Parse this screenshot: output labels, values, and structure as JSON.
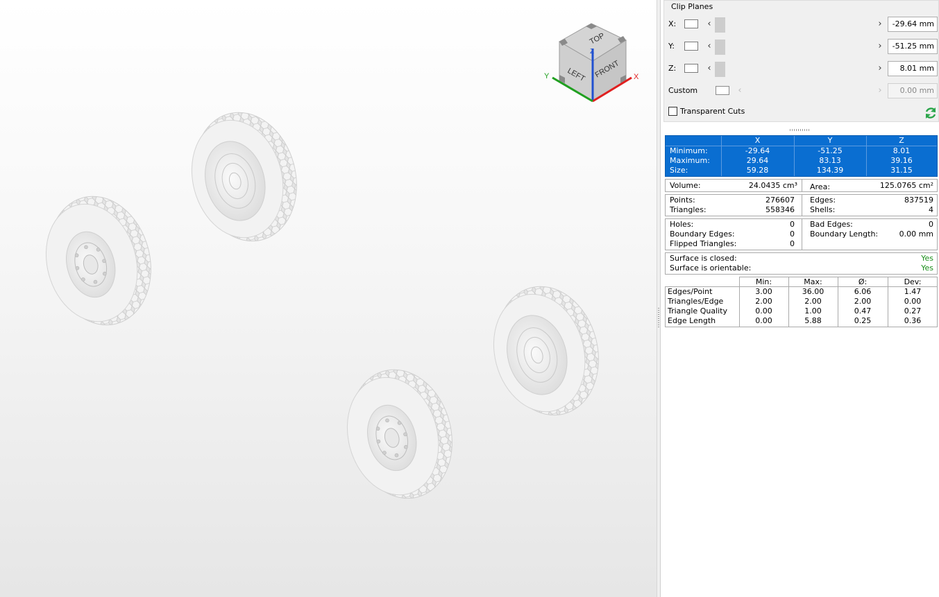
{
  "clip_planes": {
    "title": "Clip Planes",
    "rows": [
      {
        "label": "X:",
        "value": "-29.64 mm"
      },
      {
        "label": "Y:",
        "value": "-51.25 mm"
      },
      {
        "label": "Z:",
        "value": "8.01 mm"
      },
      {
        "label": "Custom",
        "value": "0.00 mm"
      }
    ],
    "transparent_cuts": "Transparent Cuts"
  },
  "nav_cube": {
    "top": "TOP",
    "left": "LEFT",
    "front": "FRONT",
    "x": "X",
    "y": "Y",
    "z": "Z"
  },
  "bbox": {
    "headers": [
      "X",
      "Y",
      "Z"
    ],
    "rows": [
      {
        "label": "Minimum:",
        "values": [
          "-29.64",
          "-51.25",
          "8.01"
        ]
      },
      {
        "label": "Maximum:",
        "values": [
          "29.64",
          "83.13",
          "39.16"
        ]
      },
      {
        "label": "Size:",
        "values": [
          "59.28",
          "134.39",
          "31.15"
        ]
      }
    ]
  },
  "volume": {
    "label": "Volume:",
    "value": "24.0435 cm³"
  },
  "area": {
    "label": "Area:",
    "value": "125.0765 cm²"
  },
  "mesh": {
    "points_label": "Points:",
    "points": "276607",
    "triangles_label": "Triangles:",
    "triangles": "558346",
    "edges_label": "Edges:",
    "edges": "837519",
    "shells_label": "Shells:",
    "shells": "4"
  },
  "errors": {
    "holes_label": "Holes:",
    "holes": "0",
    "boundary_edges_label": "Boundary Edges:",
    "boundary_edges": "0",
    "flipped_label": "Flipped Triangles:",
    "flipped": "0",
    "bad_edges_label": "Bad Edges:",
    "bad_edges": "0",
    "boundary_length_label": "Boundary Length:",
    "boundary_length": "0.00 mm"
  },
  "surface": {
    "closed_label": "Surface is closed:",
    "closed": "Yes",
    "orientable_label": "Surface is orientable:",
    "orientable": "Yes"
  },
  "quality": {
    "headers": [
      "Min:",
      "Max:",
      "Ø:",
      "Dev:"
    ],
    "rows": [
      {
        "label": "Edges/Point",
        "values": [
          "3.00",
          "36.00",
          "6.06",
          "1.47"
        ]
      },
      {
        "label": "Triangles/Edge",
        "values": [
          "2.00",
          "2.00",
          "2.00",
          "0.00"
        ]
      },
      {
        "label": "Triangle Quality",
        "values": [
          "0.00",
          "1.00",
          "0.47",
          "0.27"
        ]
      },
      {
        "label": "Edge Length",
        "values": [
          "0.00",
          "5.88",
          "0.25",
          "0.36"
        ]
      }
    ]
  },
  "colors": {
    "selection_blue": "#0a6ed1",
    "yes_green": "#1a8f1a",
    "axis_x": "#e02020",
    "axis_y": "#20a020",
    "axis_z": "#2050d0"
  }
}
